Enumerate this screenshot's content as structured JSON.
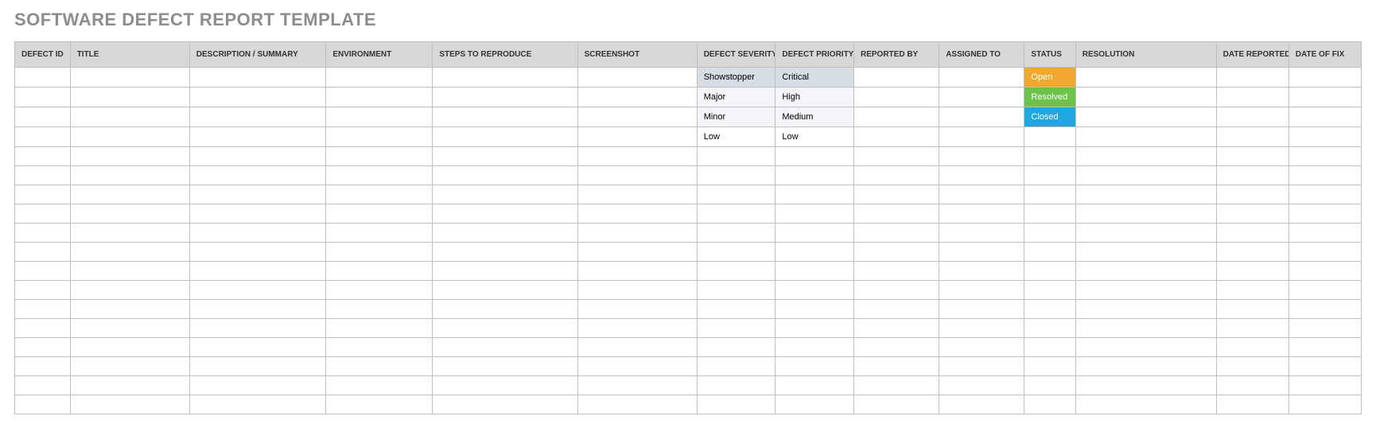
{
  "page": {
    "title": "SOFTWARE DEFECT REPORT TEMPLATE"
  },
  "columns": {
    "defect_id": "DEFECT ID",
    "title": "TITLE",
    "description": "DESCRIPTION / SUMMARY",
    "environment": "ENVIRONMENT",
    "steps": "STEPS TO REPRODUCE",
    "screenshot": "SCREENSHOT",
    "severity": "DEFECT SEVERITY",
    "priority": "DEFECT PRIORITY",
    "reported_by": "REPORTED BY",
    "assigned_to": "ASSIGNED TO",
    "status": "STATUS",
    "resolution": "RESOLUTION",
    "date_reported": "DATE REPORTED",
    "date_of_fix": "DATE OF FIX"
  },
  "rows": [
    {
      "severity": "Showstopper",
      "priority": "Critical",
      "status": "Open"
    },
    {
      "severity": "Major",
      "priority": "High",
      "status": "Resolved"
    },
    {
      "severity": "Minor",
      "priority": "Medium",
      "status": "Closed"
    },
    {
      "severity": "Low",
      "priority": "Low",
      "status": ""
    },
    {
      "severity": "",
      "priority": "",
      "status": ""
    },
    {
      "severity": "",
      "priority": "",
      "status": ""
    },
    {
      "severity": "",
      "priority": "",
      "status": ""
    },
    {
      "severity": "",
      "priority": "",
      "status": ""
    },
    {
      "severity": "",
      "priority": "",
      "status": ""
    },
    {
      "severity": "",
      "priority": "",
      "status": ""
    },
    {
      "severity": "",
      "priority": "",
      "status": ""
    },
    {
      "severity": "",
      "priority": "",
      "status": ""
    },
    {
      "severity": "",
      "priority": "",
      "status": ""
    },
    {
      "severity": "",
      "priority": "",
      "status": ""
    },
    {
      "severity": "",
      "priority": "",
      "status": ""
    },
    {
      "severity": "",
      "priority": "",
      "status": ""
    },
    {
      "severity": "",
      "priority": "",
      "status": ""
    },
    {
      "severity": "",
      "priority": "",
      "status": ""
    }
  ]
}
